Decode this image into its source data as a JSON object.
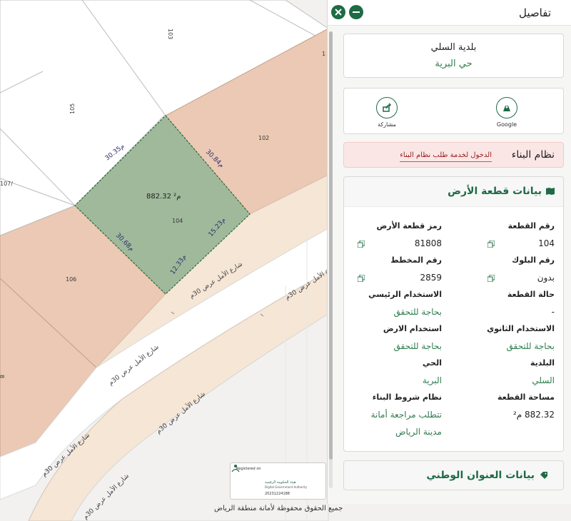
{
  "panel": {
    "title": "تفاصيل",
    "close_icon": "close-icon",
    "minimize_icon": "minimize-icon",
    "municipality": "بلدية السلي",
    "district": "حي البرية",
    "share": {
      "google_label": "Google",
      "share_label": "مشاركة"
    },
    "building_system": {
      "title": "نظام البناء",
      "link": "الدخول لخدمة طلب نظام البناء"
    },
    "land": {
      "title": "بيانات قطعة الأرض",
      "fields": {
        "parcel_number_label": "رقم القطعة",
        "parcel_number_value": "104",
        "parcel_code_label": "رمز قطعة الأرض",
        "parcel_code_value": "81808",
        "block_label": "رقم البلوك",
        "block_value": "بدون",
        "plan_label": "رقم المخطط",
        "plan_value": "2859",
        "parcel_status_label": "حالة القطعة",
        "parcel_status_value": "-",
        "main_use_label": "الاستخدام الرئيسي",
        "main_use_value": "بحاجة للتحقق",
        "secondary_use_label": "الاستخدام الثانوي",
        "secondary_use_value": "بحاجة للتحقق",
        "land_use_label": "استخدام الارض",
        "land_use_value": "بحاجة للتحقق",
        "municipality_label": "البلدية",
        "municipality_value": "السلي",
        "district_label": "الحي",
        "district_value": "البرية",
        "area_label": "مساحة القطعة",
        "area_value": "882.32 م²",
        "conditions_label": "نظام شروط البناء",
        "conditions_value_1": "تتطلب مراجعة أمانة",
        "conditions_value_2": "مدينة الرياض"
      }
    },
    "address": {
      "title": "بيانات العنوان الوطني"
    }
  },
  "map": {
    "parcel_labels": {
      "p103": "103",
      "p105": "105",
      "p102": "102",
      "p106": "106",
      "p104": "104",
      "p107": "107/",
      "p1": "1",
      "p8": "8"
    },
    "selected_area": "882.32 م²",
    "dimensions": {
      "top_left": "30.35م",
      "top_right": "30.84م",
      "bottom_left": "30.68م",
      "right": "15.23م",
      "bottom": "12.33م"
    },
    "street_label": "شارع الأمل عرض 30م",
    "street_label_partial": "شارع الأمل عرض 30م",
    "copyright": "جميع الحقوق محفوظة لأمانة منطقة الرياض",
    "stamp": {
      "registered": "Registered on",
      "authority_ar": "هيئة الحكومة الرقمية",
      "authority_en": "Digital Government Authority",
      "number": "20231224188"
    },
    "colors": {
      "selected_fill": "#9fb99a",
      "parcel_fill": "#ecc9b4",
      "road_fill": "#f5e6d6",
      "accent_green": "#1e6b46"
    }
  }
}
